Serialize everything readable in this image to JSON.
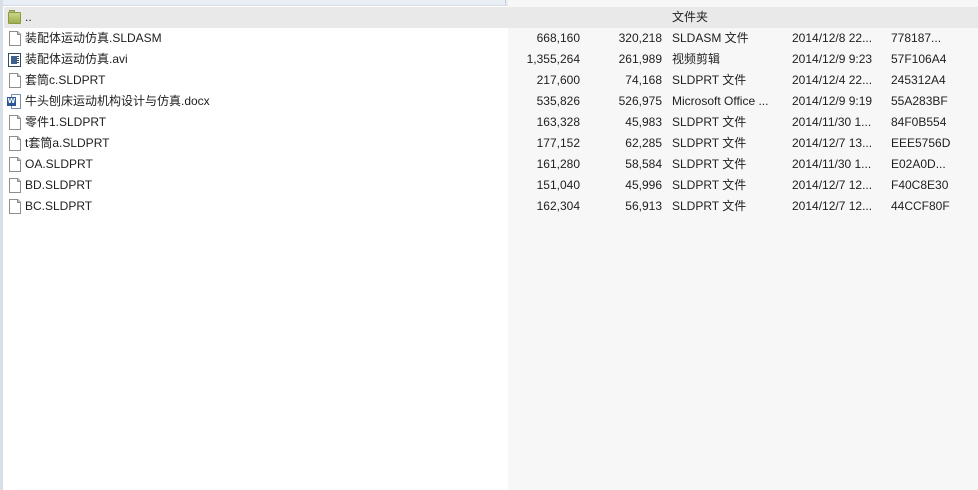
{
  "window": {
    "parent_dir_label": ".."
  },
  "files": [
    {
      "icon": "folder-up-icon",
      "name": "..",
      "size": "",
      "packed": "",
      "type": "文件夹",
      "modified": "",
      "crc": ""
    },
    {
      "icon": "document-icon",
      "name": "装配体运动仿真.SLDASM",
      "size": "668,160",
      "packed": "320,218",
      "type": "SLDASM 文件",
      "modified": "2014/12/8 22...",
      "crc": "778187..."
    },
    {
      "icon": "video-icon",
      "name": "装配体运动仿真.avi",
      "size": "1,355,264",
      "packed": "261,989",
      "type": "视频剪辑",
      "modified": "2014/12/9 9:23",
      "crc": "57F106A4"
    },
    {
      "icon": "document-icon",
      "name": "套筒c.SLDPRT",
      "size": "217,600",
      "packed": "74,168",
      "type": "SLDPRT 文件",
      "modified": "2014/12/4 22...",
      "crc": "245312A4"
    },
    {
      "icon": "word-document-icon",
      "name": "牛头刨床运动机构设计与仿真.docx",
      "size": "535,826",
      "packed": "526,975",
      "type": "Microsoft Office ...",
      "modified": "2014/12/9 9:19",
      "crc": "55A283BF"
    },
    {
      "icon": "document-icon",
      "name": "零件1.SLDPRT",
      "size": "163,328",
      "packed": "45,983",
      "type": "SLDPRT 文件",
      "modified": "2014/11/30 1...",
      "crc": "84F0B554"
    },
    {
      "icon": "document-icon",
      "name": "t套筒a.SLDPRT",
      "size": "177,152",
      "packed": "62,285",
      "type": "SLDPRT 文件",
      "modified": "2014/12/7 13...",
      "crc": "EEE5756D"
    },
    {
      "icon": "document-icon",
      "name": "OA.SLDPRT",
      "size": "161,280",
      "packed": "58,584",
      "type": "SLDPRT 文件",
      "modified": "2014/11/30 1...",
      "crc": "E02A0D..."
    },
    {
      "icon": "document-icon",
      "name": "BD.SLDPRT",
      "size": "151,040",
      "packed": "45,996",
      "type": "SLDPRT 文件",
      "modified": "2014/12/7 12...",
      "crc": "F40C8E30"
    },
    {
      "icon": "document-icon",
      "name": "BC.SLDPRT",
      "size": "162,304",
      "packed": "56,913",
      "type": "SLDPRT 文件",
      "modified": "2014/12/7 12...",
      "crc": "44CCF80F"
    }
  ],
  "colors": {
    "selected_row": "#e9e9e9",
    "right_panel_background": "#f7f7f7",
    "text": "#1e1e1e"
  }
}
